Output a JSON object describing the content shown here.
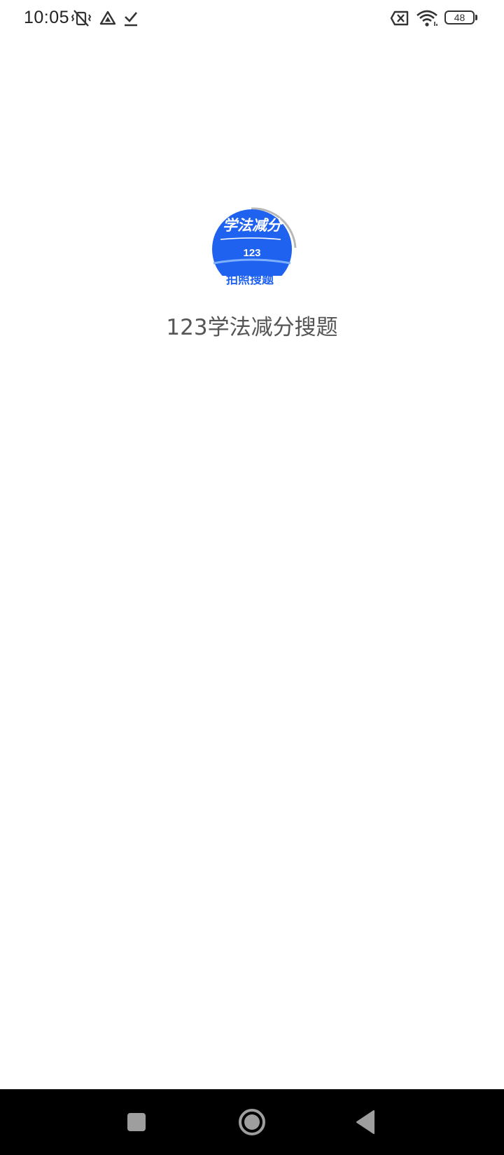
{
  "status_bar": {
    "time": "10:05",
    "battery_level": "48",
    "icons": [
      "vibrate-off-icon",
      "drive-icon",
      "download-done-icon",
      "sim-off-icon",
      "wifi-icon",
      "battery-icon"
    ]
  },
  "splash": {
    "logo": {
      "title_text": "学法减分",
      "number_text": "123",
      "subtitle_text": "拍照搜题",
      "brand_color": "#1F62F0"
    },
    "app_name": "123学法减分搜题"
  },
  "nav_bar": {
    "buttons": [
      "recents-button",
      "home-button",
      "back-button"
    ]
  }
}
